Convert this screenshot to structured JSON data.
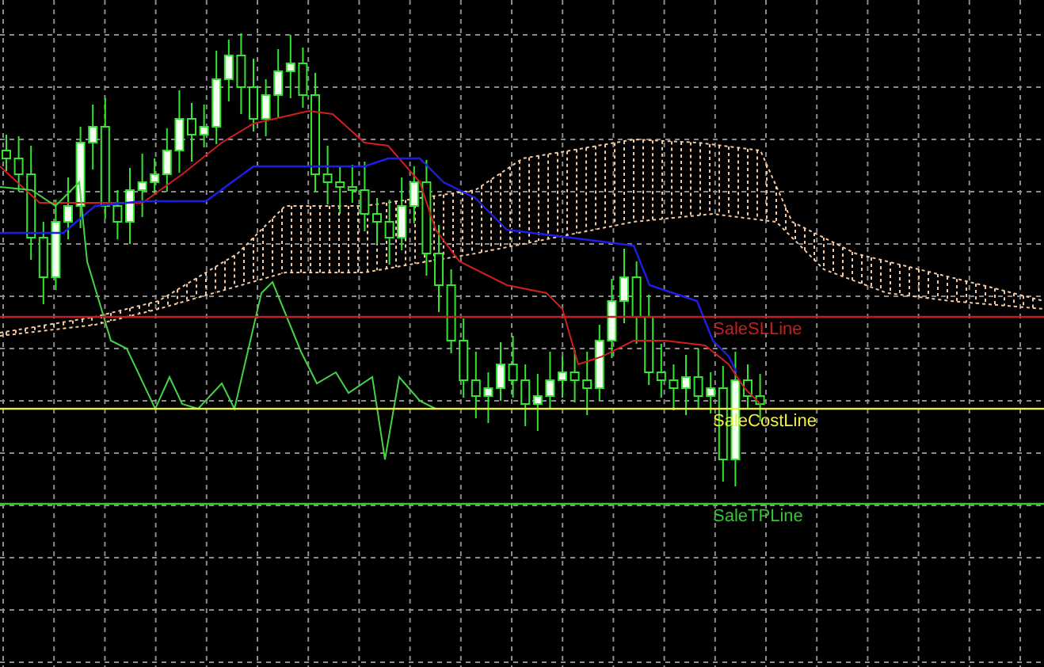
{
  "chart": {
    "price_lines": [
      {
        "label": "SaleSLLine",
        "color": "#c81e1e"
      },
      {
        "label": "SaleCostLine",
        "color": "#f0f03c"
      },
      {
        "label": "SaleTPLine",
        "color": "#32c832"
      }
    ]
  }
}
